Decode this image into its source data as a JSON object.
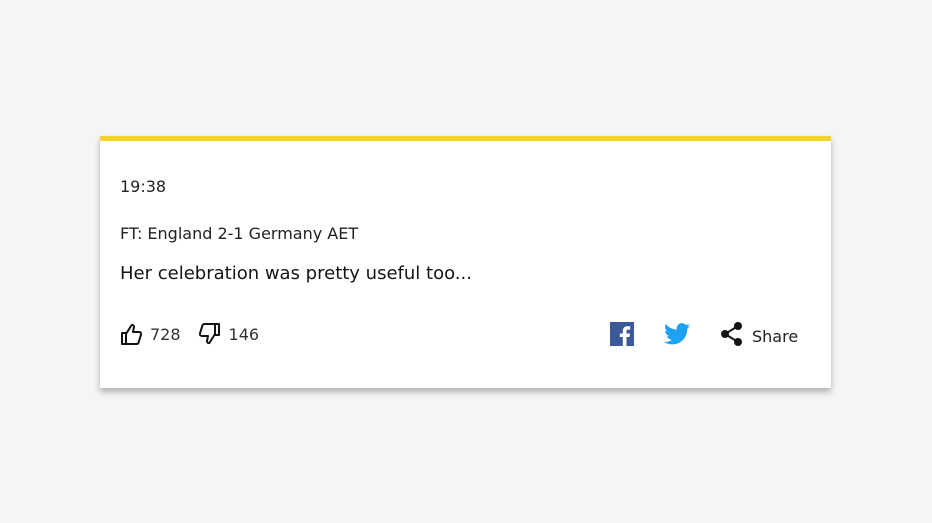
{
  "post": {
    "time": "19:38",
    "subtitle": "FT: England 2-1 Germany AET",
    "body": "Her celebration was pretty useful too..."
  },
  "reactions": {
    "like_count": "728",
    "dislike_count": "146",
    "like_icon": "thumbs-up-icon",
    "dislike_icon": "thumbs-down-icon"
  },
  "social": {
    "facebook_icon": "facebook-icon",
    "twitter_icon": "twitter-icon",
    "share_icon": "share-icon",
    "share_label": "Share"
  },
  "colors": {
    "accent_bar": "#f5cf3f",
    "facebook": "#3b5998",
    "twitter": "#1da1f2"
  }
}
